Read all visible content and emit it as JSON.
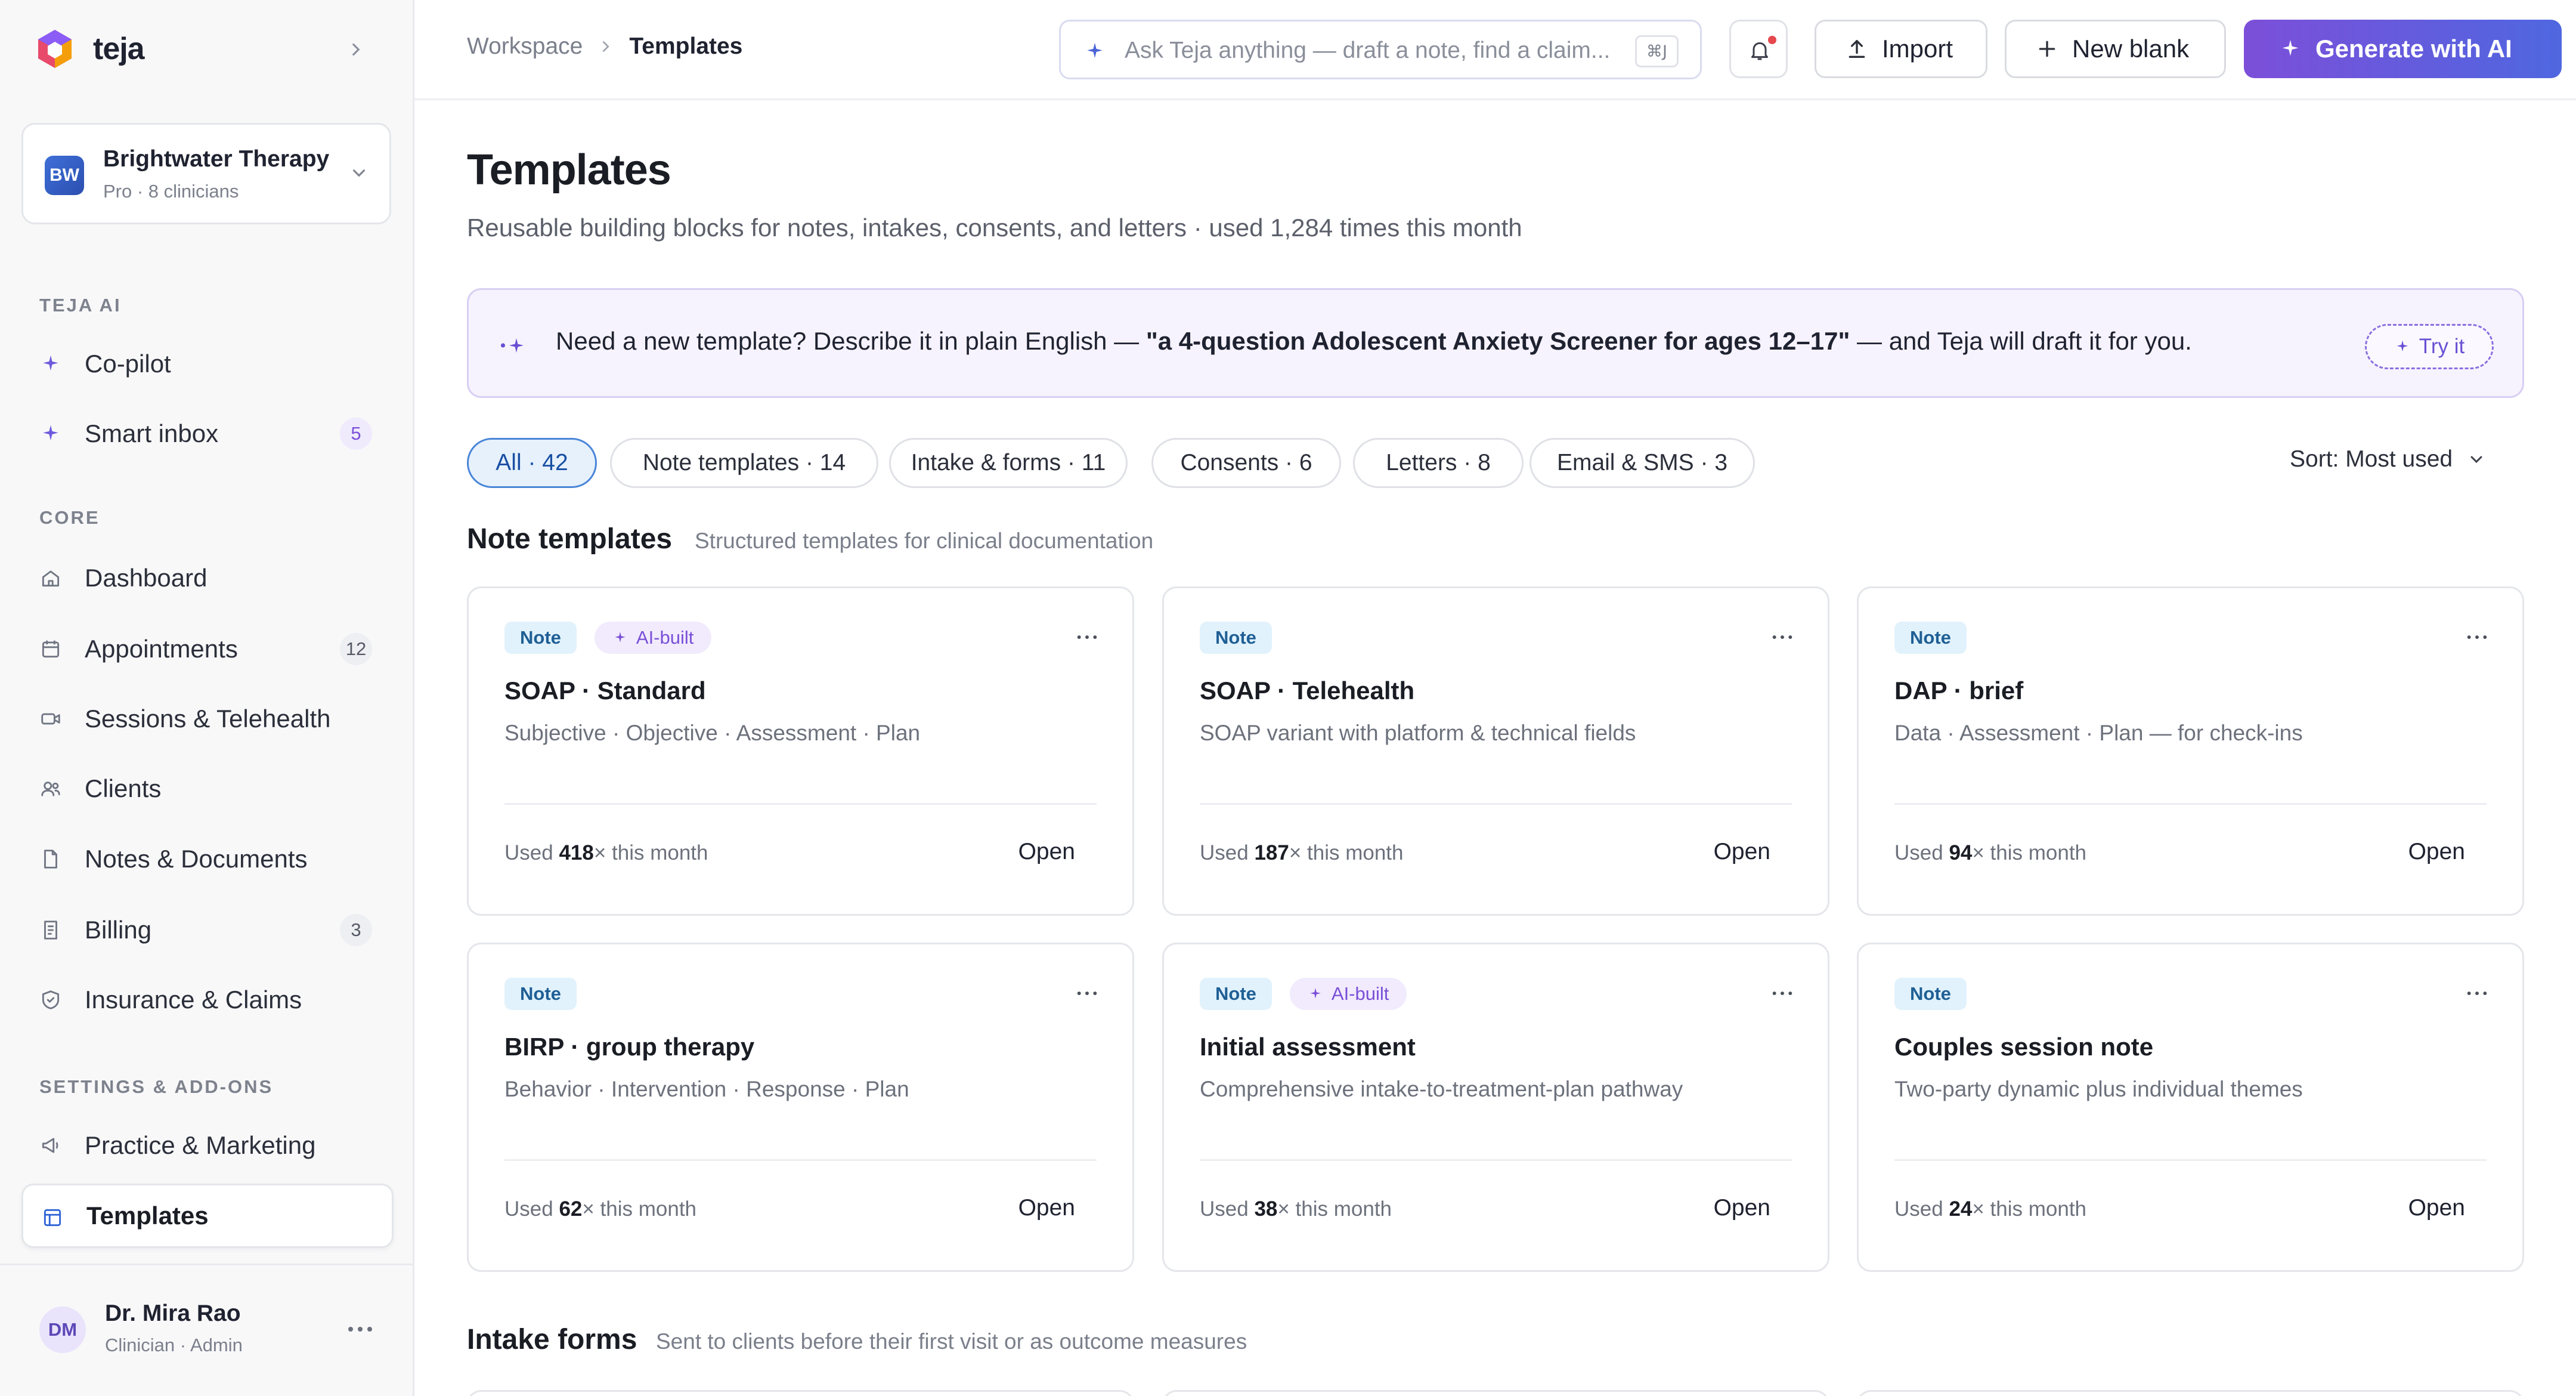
{
  "brand": {
    "name": "teja"
  },
  "org": {
    "initials": "BW",
    "name": "Brightwater Therapy",
    "plan": "Pro · 8 clinicians"
  },
  "sidebar": {
    "sections": [
      {
        "label": "TEJA AI"
      },
      {
        "label": "CORE"
      },
      {
        "label": "SETTINGS & ADD-ONS"
      }
    ],
    "items": [
      {
        "label": "Co-pilot",
        "icon": "sparkle-icon"
      },
      {
        "label": "Smart inbox",
        "icon": "sparkle-icon",
        "badge": "5"
      },
      {
        "label": "Dashboard",
        "icon": "home-icon"
      },
      {
        "label": "Appointments",
        "icon": "calendar-icon",
        "badge": "12"
      },
      {
        "label": "Sessions & Telehealth",
        "icon": "video-icon"
      },
      {
        "label": "Clients",
        "icon": "users-icon"
      },
      {
        "label": "Notes & Documents",
        "icon": "document-icon"
      },
      {
        "label": "Billing",
        "icon": "receipt-icon",
        "badge": "3"
      },
      {
        "label": "Insurance & Claims",
        "icon": "shield-icon"
      },
      {
        "label": "Practice & Marketing",
        "icon": "megaphone-icon"
      },
      {
        "label": "Templates",
        "icon": "template-icon",
        "active": true
      }
    ]
  },
  "user": {
    "initials": "DM",
    "name": "Dr. Mira Rao",
    "role": "Clinician · Admin"
  },
  "topbar": {
    "breadcrumb": [
      "Workspace",
      "Templates"
    ],
    "search_placeholder": "Ask Teja anything — draft a note, find a claim...",
    "search_shortcut": "⌘J",
    "import_label": "Import",
    "new_blank_label": "New blank",
    "generate_label": "Generate with AI"
  },
  "page": {
    "title": "Templates",
    "subtitle": "Reusable building blocks for notes, intakes, consents, and letters · used 1,284 times this month"
  },
  "banner": {
    "text_before": "Need a new template? Describe it in plain English — ",
    "example": "\"a 4-question Adolescent Anxiety Screener for ages 12–17\"",
    "text_after": " — and Teja will draft it for you.",
    "try_label": "Try it"
  },
  "filters": {
    "chips": [
      "All · 42",
      "Note templates · 14",
      "Intake & forms · 11",
      "Consents · 6",
      "Letters · 8",
      "Email & SMS · 3"
    ],
    "active_index": 0,
    "sort_label": "Sort: Most used"
  },
  "sections": {
    "notes": {
      "title": "Note templates",
      "desc": "Structured templates for clinical documentation"
    },
    "intake": {
      "title": "Intake forms",
      "desc": "Sent to clients before their first visit or as outcome measures"
    }
  },
  "card_labels": {
    "used_prefix": "Used ",
    "used_suffix": "× this month",
    "open": "Open",
    "ai_badge": "AI-built"
  },
  "note_cards": [
    {
      "tag": "Note",
      "ai": true,
      "title": "SOAP · Standard",
      "desc": "Subjective · Objective · Assessment · Plan",
      "used": "418"
    },
    {
      "tag": "Note",
      "ai": false,
      "title": "SOAP · Telehealth",
      "desc": "SOAP variant with platform & technical fields",
      "used": "187"
    },
    {
      "tag": "Note",
      "ai": false,
      "title": "DAP · brief",
      "desc": "Data · Assessment · Plan — for check-ins",
      "used": "94"
    },
    {
      "tag": "Note",
      "ai": false,
      "title": "BIRP · group therapy",
      "desc": "Behavior · Intervention · Response · Plan",
      "used": "62"
    },
    {
      "tag": "Note",
      "ai": true,
      "title": "Initial assessment",
      "desc": "Comprehensive intake-to-treatment-plan pathway",
      "used": "38"
    },
    {
      "tag": "Note",
      "ai": false,
      "title": "Couples session note",
      "desc": "Two-party dynamic plus individual themes",
      "used": "24"
    }
  ],
  "colors": {
    "accent": "#7c4fd9",
    "accent2": "#4f67e0",
    "note_tag": "#e1f2fc",
    "ai_tag": "#f1ebfd"
  }
}
